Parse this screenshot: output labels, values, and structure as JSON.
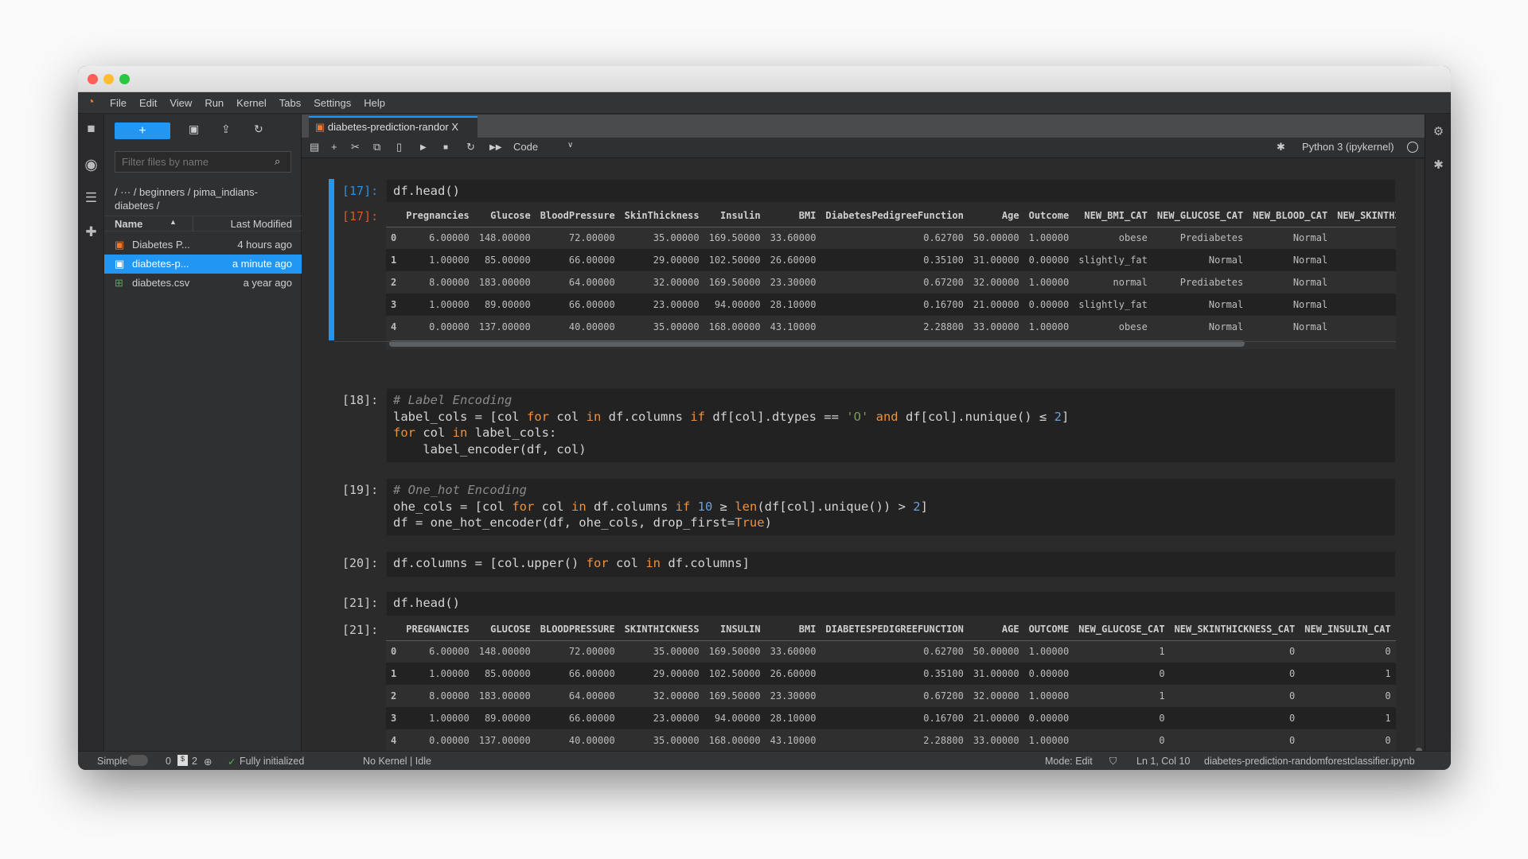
{
  "colors": {
    "accent": "#2196f3",
    "close": "#ff5f57",
    "minimize": "#febc2e",
    "zoom": "#28c840",
    "keyword": "#f0903a",
    "prompt_in": "#2f8ee0",
    "prompt_out": "#d8572e"
  },
  "menu": [
    "File",
    "Edit",
    "View",
    "Run",
    "Kernel",
    "Tabs",
    "Settings",
    "Help"
  ],
  "filebrowser": {
    "new_label": "+",
    "filter_placeholder": "Filter files by name",
    "breadcrumb": "/  ···  / beginners / pima_indians-diabetes /",
    "col_name": "Name",
    "col_modified": "Last Modified",
    "files": [
      {
        "name": "Diabetes P...",
        "modified": "4 hours ago",
        "icon": "notebook-icon"
      },
      {
        "name": "diabetes-p...",
        "modified": "a minute ago",
        "icon": "notebook-icon",
        "selected": true
      },
      {
        "name": "diabetes.csv",
        "modified": "a year ago",
        "icon": "spreadsheet-icon"
      }
    ]
  },
  "tab": {
    "title": "diabetes-prediction-randor",
    "close": "X"
  },
  "toolbar": {
    "cell_type": "Code",
    "kernel": "Python 3 (ipykernel)"
  },
  "cells": [
    {
      "prompt": "[17]:",
      "code": [
        [
          [
            "df.head()",
            ""
          ]
        ]
      ],
      "out_prompt": "[17]:"
    },
    {
      "prompt": "[18]:",
      "code": [
        [
          [
            "# Label Encoding",
            "cm"
          ]
        ],
        [
          [
            "label_cols = [col ",
            ""
          ],
          [
            "for",
            "kw"
          ],
          [
            " col ",
            ""
          ],
          [
            "in",
            "kw"
          ],
          [
            " df.columns ",
            ""
          ],
          [
            "if",
            "kw"
          ],
          [
            " df[col].dtypes == ",
            ""
          ],
          [
            "'O'",
            "str"
          ],
          [
            " ",
            ""
          ],
          [
            "and",
            "kw"
          ],
          [
            " df[col].nunique() ≤ ",
            ""
          ],
          [
            "2",
            "num"
          ],
          [
            "]",
            ""
          ]
        ],
        [
          [
            "for",
            "kw"
          ],
          [
            " col ",
            ""
          ],
          [
            "in",
            "kw"
          ],
          [
            " label_cols:",
            ""
          ]
        ],
        [
          [
            "    label_encoder(df, col)",
            ""
          ]
        ]
      ]
    },
    {
      "prompt": "[19]:",
      "code": [
        [
          [
            "# One_hot Encoding",
            "cm"
          ]
        ],
        [
          [
            "ohe_cols = [col ",
            ""
          ],
          [
            "for",
            "kw"
          ],
          [
            " col ",
            ""
          ],
          [
            "in",
            "kw"
          ],
          [
            " df.columns ",
            ""
          ],
          [
            "if",
            "kw"
          ],
          [
            " ",
            ""
          ],
          [
            "10",
            "num"
          ],
          [
            " ≥ ",
            ""
          ],
          [
            "len",
            "kw"
          ],
          [
            "(df[col].unique()) > ",
            ""
          ],
          [
            "2",
            "num"
          ],
          [
            "]",
            ""
          ]
        ],
        [
          [
            "df = one_hot_encoder(df, ohe_cols, drop_first=",
            ""
          ],
          [
            "True",
            "kw"
          ],
          [
            ")",
            ""
          ]
        ]
      ]
    },
    {
      "prompt": "[20]:",
      "code": [
        [
          [
            "df.columns = [col.upper() ",
            ""
          ],
          [
            "for",
            "kw"
          ],
          [
            " col ",
            ""
          ],
          [
            "in",
            "kw"
          ],
          [
            " df.columns]",
            ""
          ]
        ]
      ]
    },
    {
      "prompt": "[21]:",
      "code": [
        [
          [
            "df.head()",
            ""
          ]
        ]
      ],
      "out_prompt": "[21]:"
    }
  ],
  "table1": {
    "columns": [
      "",
      "Pregnancies",
      "Glucose",
      "BloodPressure",
      "SkinThickness",
      "Insulin",
      "BMI",
      "DiabetesPedigreeFunction",
      "Age",
      "Outcome",
      "NEW_BMI_CAT",
      "NEW_GLUCOSE_CAT",
      "NEW_BLOOD_CAT",
      "NEW_SKINTHI"
    ],
    "rows": [
      [
        "0",
        "6.00000",
        "148.00000",
        "72.00000",
        "35.00000",
        "169.50000",
        "33.60000",
        "0.62700",
        "50.00000",
        "1.00000",
        "obese",
        "Prediabetes",
        "Normal",
        ""
      ],
      [
        "1",
        "1.00000",
        "85.00000",
        "66.00000",
        "29.00000",
        "102.50000",
        "26.60000",
        "0.35100",
        "31.00000",
        "0.00000",
        "slightly_fat",
        "Normal",
        "Normal",
        ""
      ],
      [
        "2",
        "8.00000",
        "183.00000",
        "64.00000",
        "32.00000",
        "169.50000",
        "23.30000",
        "0.67200",
        "32.00000",
        "1.00000",
        "normal",
        "Prediabetes",
        "Normal",
        ""
      ],
      [
        "3",
        "1.00000",
        "89.00000",
        "66.00000",
        "23.00000",
        "94.00000",
        "28.10000",
        "0.16700",
        "21.00000",
        "0.00000",
        "slightly_fat",
        "Normal",
        "Normal",
        ""
      ],
      [
        "4",
        "0.00000",
        "137.00000",
        "40.00000",
        "35.00000",
        "168.00000",
        "43.10000",
        "2.28800",
        "33.00000",
        "1.00000",
        "obese",
        "Normal",
        "Normal",
        ""
      ]
    ]
  },
  "table2": {
    "columns": [
      "",
      "PREGNANCIES",
      "GLUCOSE",
      "BLOODPRESSURE",
      "SKINTHICKNESS",
      "INSULIN",
      "BMI",
      "DIABETESPEDIGREEFUNCTION",
      "AGE",
      "OUTCOME",
      "NEW_GLUCOSE_CAT",
      "NEW_SKINTHICKNESS_CAT",
      "NEW_INSULIN_CAT"
    ],
    "rows": [
      [
        "0",
        "6.00000",
        "148.00000",
        "72.00000",
        "35.00000",
        "169.50000",
        "33.60000",
        "0.62700",
        "50.00000",
        "1.00000",
        "1",
        "0",
        "0"
      ],
      [
        "1",
        "1.00000",
        "85.00000",
        "66.00000",
        "29.00000",
        "102.50000",
        "26.60000",
        "0.35100",
        "31.00000",
        "0.00000",
        "0",
        "0",
        "1"
      ],
      [
        "2",
        "8.00000",
        "183.00000",
        "64.00000",
        "32.00000",
        "169.50000",
        "23.30000",
        "0.67200",
        "32.00000",
        "1.00000",
        "1",
        "0",
        "0"
      ],
      [
        "3",
        "1.00000",
        "89.00000",
        "66.00000",
        "23.00000",
        "94.00000",
        "28.10000",
        "0.16700",
        "21.00000",
        "0.00000",
        "0",
        "0",
        "1"
      ],
      [
        "4",
        "0.00000",
        "137.00000",
        "40.00000",
        "35.00000",
        "168.00000",
        "43.10000",
        "2.28800",
        "33.00000",
        "1.00000",
        "0",
        "0",
        "0"
      ]
    ]
  },
  "status": {
    "mode_label": "Simple",
    "count0": "0",
    "terminals": "2",
    "init": "Fully initialized",
    "kernel": "No Kernel | Idle",
    "mode": "Mode: Edit",
    "position": "Ln 1, Col 10",
    "filename": "diabetes-prediction-randomforestclassifier.ipynb"
  }
}
